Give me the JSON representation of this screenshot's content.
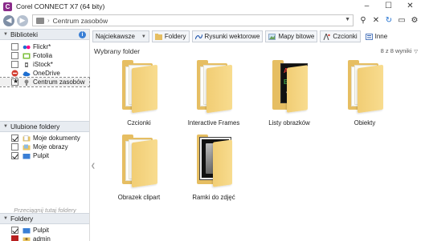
{
  "window": {
    "title": "Corel CONNECT X7 (64 bity)",
    "app_icon_glyph": "C",
    "minimize": "–",
    "maximize": "☐",
    "close": "✕"
  },
  "address": {
    "location": "Centrum zasobów"
  },
  "left_panel": {
    "libraries": {
      "header": "Biblioteki",
      "items": [
        {
          "label": "Flickr*",
          "checked": false,
          "icon": "flickr-icon",
          "color": "#ff0084"
        },
        {
          "label": "Fotolia",
          "checked": false,
          "icon": "fotolia-icon",
          "color": "#7bbf3a"
        },
        {
          "label": "iStock*",
          "checked": false,
          "icon": "istock-icon",
          "color": "#444444"
        },
        {
          "label": "OneDrive",
          "checked": false,
          "icon": "onedrive-icon",
          "color": "#1e6fd0"
        },
        {
          "label": "Centrum zasobów",
          "checked": true,
          "icon": "content-hub-icon",
          "color": "#777777"
        }
      ]
    },
    "favorites": {
      "header": "Ulubione foldery",
      "items": [
        {
          "label": "Moje dokumenty",
          "checked": true
        },
        {
          "label": "Moje obrazy",
          "checked": false
        },
        {
          "label": "Pulpit",
          "checked": true
        }
      ],
      "drop_hint": "Przeciągnij tutaj foldery"
    },
    "folders": {
      "header": "Foldery",
      "items": [
        {
          "label": "Pulpit",
          "checked": true
        },
        {
          "label": "admin",
          "checked": false
        }
      ]
    }
  },
  "toolbar": {
    "sort_label": "Najciekawsze",
    "buttons": [
      {
        "label": "Foldery",
        "icon": "folder-icon"
      },
      {
        "label": "Rysunki wektorowe",
        "icon": "vector-icon"
      },
      {
        "label": "Mapy bitowe",
        "icon": "bitmap-icon"
      },
      {
        "label": "Czcionki",
        "icon": "font-icon"
      },
      {
        "label": "Inne",
        "icon": "other-icon"
      }
    ]
  },
  "main": {
    "section_title": "Wybrany folder",
    "results": "8 z 8 wyniki",
    "folders": [
      {
        "label": "Czcionki",
        "preview": "none"
      },
      {
        "label": "Interactive Frames",
        "preview": "none"
      },
      {
        "label": "Listy obrazków",
        "preview": "dark-letters"
      },
      {
        "label": "Obiekty",
        "preview": "none"
      },
      {
        "label": "Obrazek clipart",
        "preview": "none"
      },
      {
        "label": "Ramki do zdjęć",
        "preview": "frame"
      }
    ]
  }
}
